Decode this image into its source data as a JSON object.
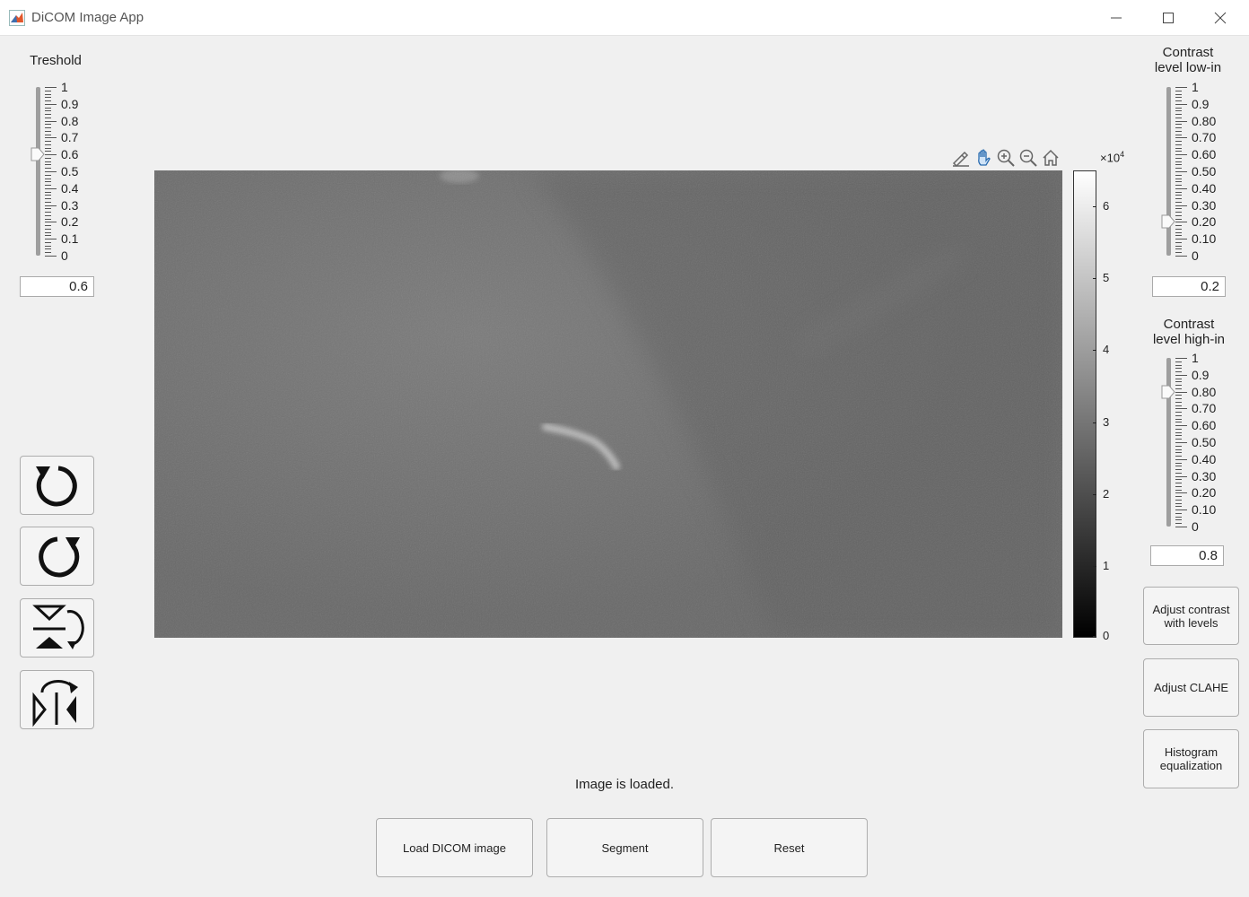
{
  "window": {
    "title": "DiCOM Image App"
  },
  "threshold": {
    "label": "Treshold",
    "ticks": [
      "1",
      "0.9",
      "0.8",
      "0.7",
      "0.6",
      "0.5",
      "0.4",
      "0.3",
      "0.2",
      "0.1",
      "0"
    ],
    "value": 0.6,
    "display": "0.6"
  },
  "contrast_low": {
    "label_line1": "Contrast",
    "label_line2": "level low-in",
    "ticks": [
      "1",
      "0.9",
      "0.80",
      "0.70",
      "0.60",
      "0.50",
      "0.40",
      "0.30",
      "0.20",
      "0.10",
      "0"
    ],
    "value": 0.2,
    "display": "0.2"
  },
  "contrast_high": {
    "label_line1": "Contrast",
    "label_line2": "level high-in",
    "ticks": [
      "1",
      "0.9",
      "0.80",
      "0.70",
      "0.60",
      "0.50",
      "0.40",
      "0.30",
      "0.20",
      "0.10",
      "0"
    ],
    "value": 0.8,
    "display": "0.8"
  },
  "tools": [
    "rotate-counterclockwise",
    "rotate-clockwise",
    "flip-vertical",
    "flip-horizontal"
  ],
  "axes_toolbar": [
    "brush-icon",
    "pan-icon",
    "zoom-in-icon",
    "zoom-out-icon",
    "home-icon"
  ],
  "colorbar": {
    "exponent_base": "×10",
    "exponent_power": "4",
    "ticks": [
      "6",
      "5",
      "4",
      "3",
      "2",
      "1",
      "0"
    ],
    "range": [
      0,
      6.5
    ]
  },
  "status": {
    "text": "Image is loaded."
  },
  "buttons": {
    "load": "Load DICOM image",
    "segment": "Segment",
    "reset": "Reset",
    "adjust_levels_1": "Adjust contrast",
    "adjust_levels_2": "with levels",
    "clahe": "Adjust CLAHE",
    "histeq_1": "Histogram",
    "histeq_2": "equalization"
  }
}
